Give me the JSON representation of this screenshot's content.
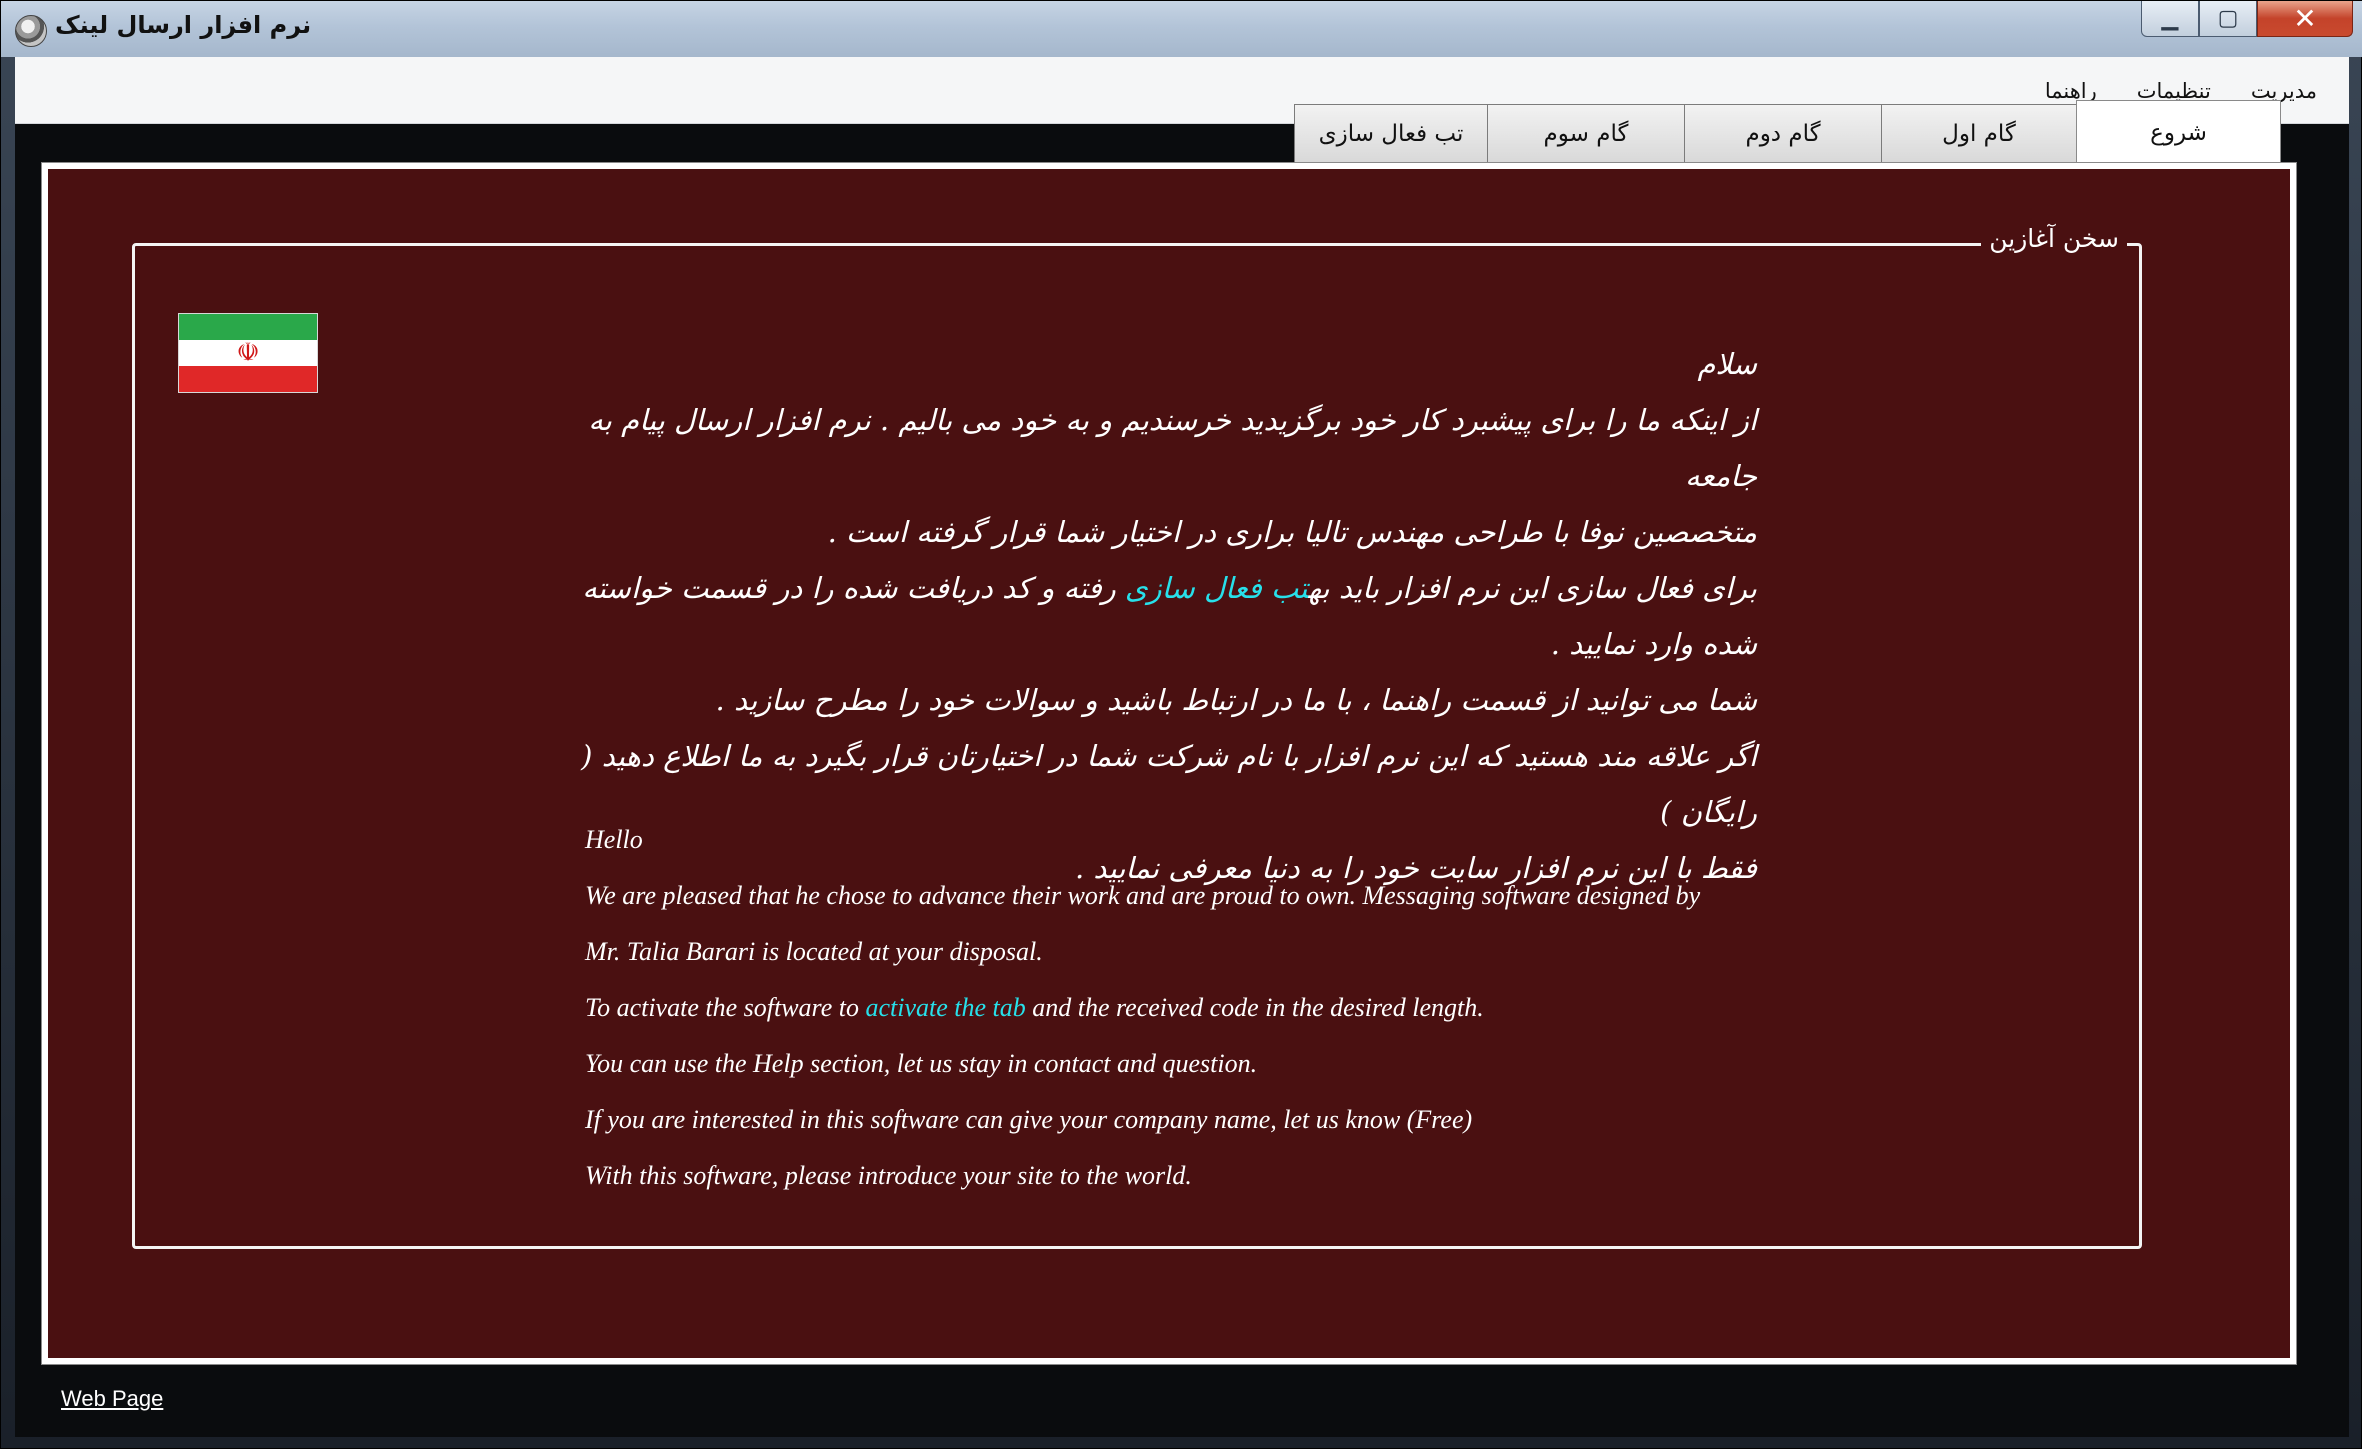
{
  "window": {
    "title": "نرم افزار ارسال لینک",
    "minimize_glyph": "▁",
    "maximize_glyph": "▢",
    "close_glyph": "✕"
  },
  "menu": {
    "items": [
      "مدیریت",
      "تنظیمات",
      "راهنما"
    ]
  },
  "tabs": [
    "شروع",
    "گام اول",
    "گام دوم",
    "گام سوم",
    "تب فعال سازی"
  ],
  "active_tab": "شروع",
  "intro": {
    "group_title": "سخن آغازین",
    "fa": {
      "line1": "سلام",
      "line2": "از اینکه ما را برای پیشبرد کار خود برگزیدید خرسندیم و به خود می بالیم . نرم افزار ارسال پیام به جامعه",
      "line3": "متخصصین نوفا با طراحی مهندس تالیا براری در اختیار شما قرار گرفته است .",
      "line4_pre": "برای فعال سازی این نرم افزار باید به",
      "line4_link": "تب فعال سازی",
      "line4_post": "رفته و کد دریافت شده را در قسمت خواسته",
      "line5": "شده وارد نمایید .",
      "line6": "شما می توانید از قسمت راهنما ، با ما در ارتباط باشید و سوالات خود را مطرح سازید .",
      "line7": "اگر علاقه مند هستید که این نرم افزار با نام شرکت شما در اختیارتان قرار بگیرد به ما اطلاع دهید ( رایگان )",
      "line8": "فقط با این نرم افزار سایت خود را به دنیا معرفی نمایید ."
    },
    "en": {
      "line1": "Hello",
      "line2": "We are pleased that he chose to advance their work and are proud to own. Messaging software designed by",
      "line3": "Mr. Talia Barari is located at your disposal.",
      "line4_pre": "To activate the software to ",
      "line4_link": "activate the tab",
      "line4_post": " and the received code in the desired length.",
      "line5": "You can use the Help section, let us stay in contact and question.",
      "line6": "If you are interested in this software can give your company name, let us know (Free)",
      "line7": "With this software, please introduce your site to the world."
    }
  },
  "footer": {
    "web_page_link": "Web Page"
  },
  "colors": {
    "panel_background": "#4a1011",
    "link_cyan": "#27e0ea",
    "flag_green": "#2aa84a",
    "flag_red": "#e02828"
  },
  "icons": {
    "app": "app-icon",
    "flag": "iran-flag-icon"
  }
}
